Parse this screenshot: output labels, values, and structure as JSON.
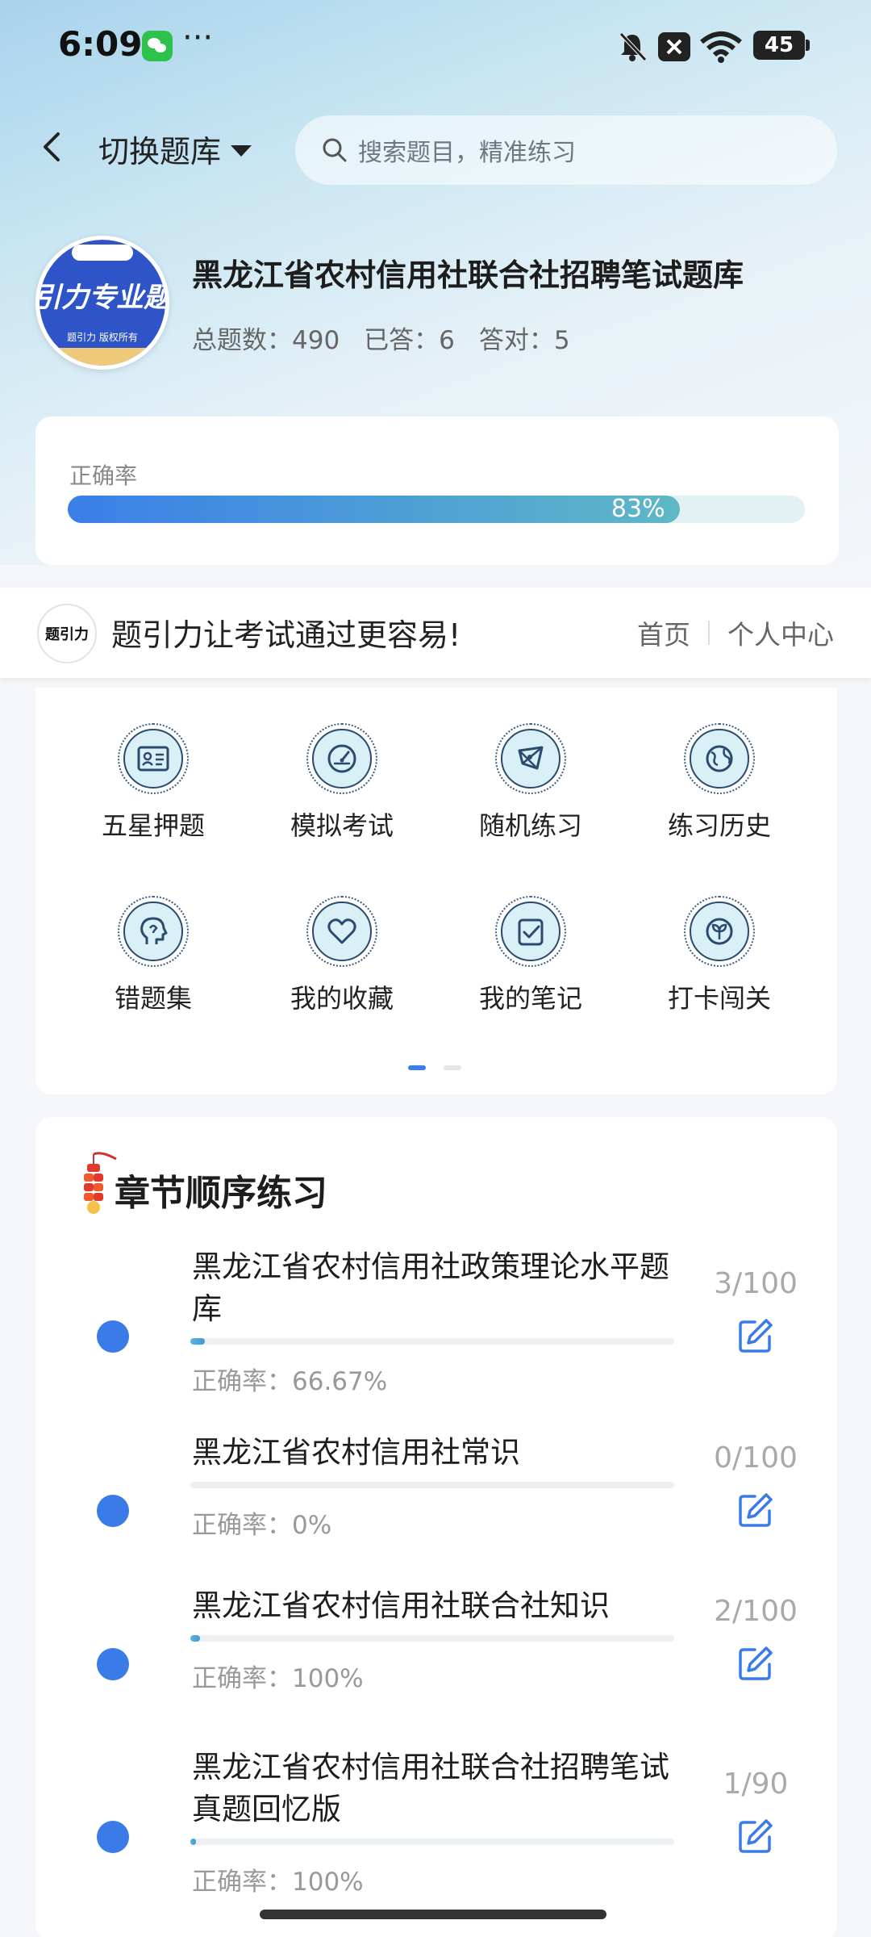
{
  "status_bar": {
    "time": "6:09",
    "more": "···",
    "battery": "45"
  },
  "nav": {
    "switch_label": "切换题库",
    "search_placeholder": "搜索题目，精准练习"
  },
  "bank": {
    "logo_text": "引力专业题",
    "logo_sub": "题引力 版权所有",
    "title": "黑龙江省农村信用社联合社招聘笔试题库",
    "stats": {
      "total_label": "总题数：490",
      "answered_label": "已答：6",
      "correct_label": "答对：5"
    }
  },
  "accuracy": {
    "label": "正确率",
    "value_text": "83%",
    "value": 0.83
  },
  "promo": {
    "logo_text": "题引力",
    "text": "题引力让考试通过更容易!",
    "home_link": "首页",
    "profile_link": "个人中心"
  },
  "features": [
    {
      "label": "五星押题",
      "icon": "id-card-icon"
    },
    {
      "label": "模拟考试",
      "icon": "speedometer-icon"
    },
    {
      "label": "随机练习",
      "icon": "random-shape-icon"
    },
    {
      "label": "练习历史",
      "icon": "globe-icon"
    },
    {
      "label": "错题集",
      "icon": "head-icon"
    },
    {
      "label": "我的收藏",
      "icon": "heart-icon"
    },
    {
      "label": "我的笔记",
      "icon": "note-check-icon"
    },
    {
      "label": "打卡闯关",
      "icon": "sprout-icon"
    }
  ],
  "chapters": {
    "title": "章节顺序练习",
    "items": [
      {
        "name": "黑龙江省农村信用社政策理论水平题库",
        "accuracy": "正确率：66.67%",
        "count": "3/100",
        "progress": 0.03
      },
      {
        "name": "黑龙江省农村信用社常识",
        "accuracy": "正确率：0%",
        "count": "0/100",
        "progress": 0.0
      },
      {
        "name": "黑龙江省农村信用社联合社知识",
        "accuracy": "正确率：100%",
        "count": "2/100",
        "progress": 0.02
      },
      {
        "name": "黑龙江省农村信用社联合社招聘笔试真题回忆版",
        "accuracy": "正确率：100%",
        "count": "1/90",
        "progress": 0.011
      }
    ]
  },
  "colors": {
    "accent": "#3a7be8",
    "progress_track": "#e2f2f4",
    "logo_blue": "#2f54c7"
  }
}
